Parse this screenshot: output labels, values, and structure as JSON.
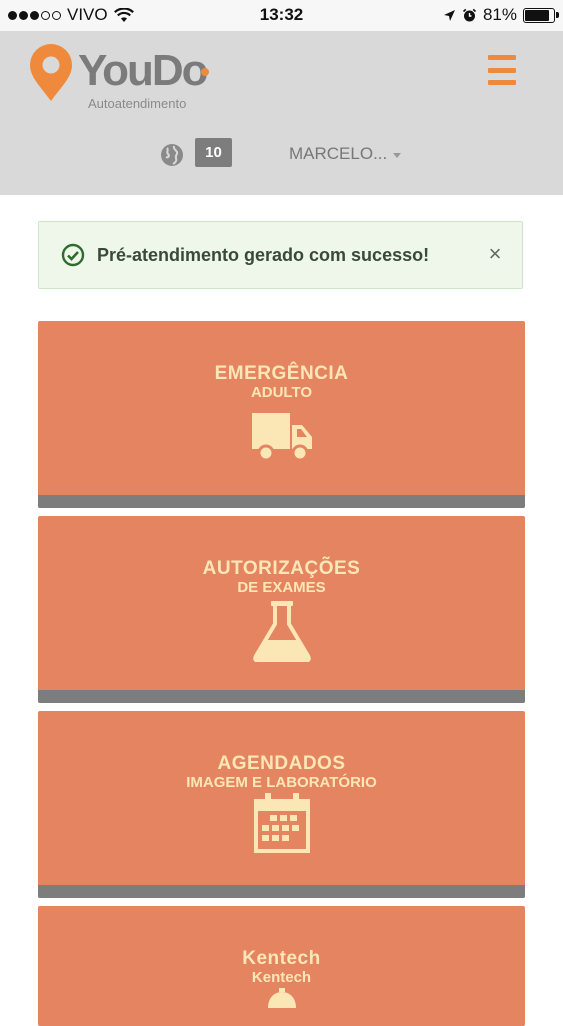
{
  "status_bar": {
    "carrier": "VIVO",
    "time": "13:32",
    "battery": "81%"
  },
  "header": {
    "logo_text": "YouDo",
    "logo_subtitle": "Autoatendimento",
    "count": "10",
    "user": "MARCELO...",
    "menu_icon": "hamburger-icon",
    "globe_icon": "globe-icon"
  },
  "alert": {
    "message": "Pré-atendimento gerado com sucesso!",
    "close": "×"
  },
  "tiles": [
    {
      "title": "EMERGÊNCIA",
      "subtitle": "ADULTO",
      "icon": "truck-icon"
    },
    {
      "title": "AUTORIZAÇÕES",
      "subtitle": "DE EXAMES",
      "icon": "flask-icon"
    },
    {
      "title": "AGENDADOS",
      "subtitle": "IMAGEM E LABORATÓRIO",
      "icon": "calendar-icon"
    },
    {
      "title": "Kentech",
      "subtitle": "Kentech",
      "icon": "bell-icon"
    }
  ],
  "colors": {
    "accent": "#ef8a3c",
    "tile": "#e58461",
    "tile_text": "#fbe7b6",
    "tile_bar": "#7d7d7d",
    "header_bg": "#d9d9d9",
    "alert_bg": "#eef7ea",
    "success": "#2f6b2f"
  }
}
